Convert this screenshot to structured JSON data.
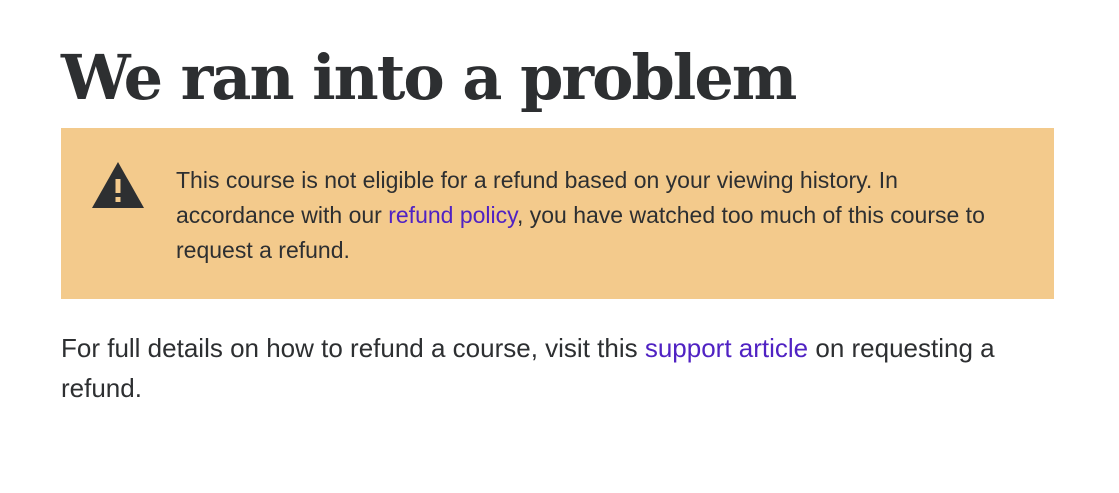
{
  "page": {
    "title": "We ran into a problem"
  },
  "alert": {
    "icon": "warning-icon",
    "background": "#f3ca8c",
    "text_before_link": "This course is not eligible for a refund based on your viewing history. In accordance with our ",
    "link_label": "refund policy",
    "text_after_link": ", you have watched too much of this course to request a refund."
  },
  "details": {
    "text_before_link": "For full details on how to refund a course, visit this ",
    "link_label": "support article",
    "text_after_link": " on requesting a refund."
  },
  "colors": {
    "text": "#2d2f31",
    "link": "#5022c3"
  }
}
